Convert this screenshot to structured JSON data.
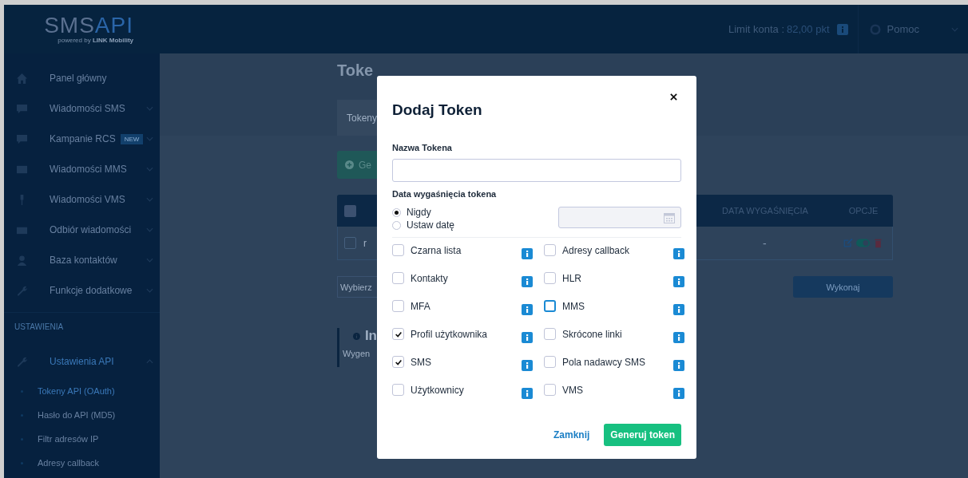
{
  "header": {
    "logo": {
      "main": "SMS",
      "accent": "API",
      "tagline": "powered by **LINK Mobility**"
    },
    "limit_label": "Limit konta :",
    "limit_value": "82,00 pkt",
    "help": "Pomoc"
  },
  "sidebar": {
    "items": [
      {
        "label": "Panel główny",
        "kind": "home",
        "expandable": false
      },
      {
        "label": "Wiadomości SMS",
        "kind": "chat",
        "expandable": true
      },
      {
        "label": "Kampanie RCS",
        "kind": "chat",
        "expandable": true,
        "badge": "NEW"
      },
      {
        "label": "Wiadomości MMS",
        "kind": "image",
        "expandable": true
      },
      {
        "label": "Wiadomości VMS",
        "kind": "mic",
        "expandable": true
      },
      {
        "label": "Odbiór wiadomości",
        "kind": "inbox",
        "expandable": true
      },
      {
        "label": "Baza kontaktów",
        "kind": "person",
        "expandable": true
      },
      {
        "label": "Funkcje dodatkowe",
        "kind": "wrench",
        "expandable": true
      }
    ],
    "section": "USTAWIENIA",
    "settings": [
      {
        "label": "Ustawienia API",
        "kind": "wrench",
        "expanded": true,
        "children": [
          {
            "label": "Tokeny API (OAuth)",
            "selected": true
          },
          {
            "label": "Hasło do API (MD5)",
            "selected": false
          },
          {
            "label": "Filtr adresów IP",
            "selected": false
          },
          {
            "label": "Adresy callback",
            "selected": false
          }
        ]
      }
    ]
  },
  "page": {
    "title": "Toke",
    "tab": "Tokeny",
    "generate_button": "Ge",
    "table": {
      "select_all_checked": false,
      "columns": [
        "DATA WYGAŚNIĘCIA",
        "OPCJE"
      ],
      "rows": [
        {
          "checked": false,
          "cell": "r",
          "expiry": "-",
          "active": true
        }
      ]
    },
    "bulk_select": "Wybierz",
    "execute_button": "Wykonaj",
    "info": {
      "title": "In",
      "text": "Wygen"
    }
  },
  "modal": {
    "title": "Dodaj Token",
    "name_label": "Nazwa Tokena",
    "expiry_label": "Data wygaśnięcia tokena",
    "expiry_options": [
      {
        "label": "Nigdy",
        "selected": true
      },
      {
        "label": "Ustaw datę",
        "selected": false
      }
    ],
    "permissions": [
      {
        "label": "Czarna lista",
        "checked": false,
        "focused": false
      },
      {
        "label": "Adresy callback",
        "checked": false,
        "focused": false
      },
      {
        "label": "Kontakty",
        "checked": false,
        "focused": false
      },
      {
        "label": "HLR",
        "checked": false,
        "focused": false
      },
      {
        "label": "MFA",
        "checked": false,
        "focused": false
      },
      {
        "label": "MMS",
        "checked": false,
        "focused": true
      },
      {
        "label": "Profil użytkownika",
        "checked": true,
        "focused": false
      },
      {
        "label": "Skrócone linki",
        "checked": false,
        "focused": false
      },
      {
        "label": "SMS",
        "checked": true,
        "focused": false
      },
      {
        "label": "Pola nadawcy SMS",
        "checked": false,
        "focused": false
      },
      {
        "label": "Użytkownicy",
        "checked": false,
        "focused": false
      },
      {
        "label": "VMS",
        "checked": false,
        "focused": false
      }
    ],
    "cancel": "Zamknij",
    "submit": "Generuj token"
  }
}
